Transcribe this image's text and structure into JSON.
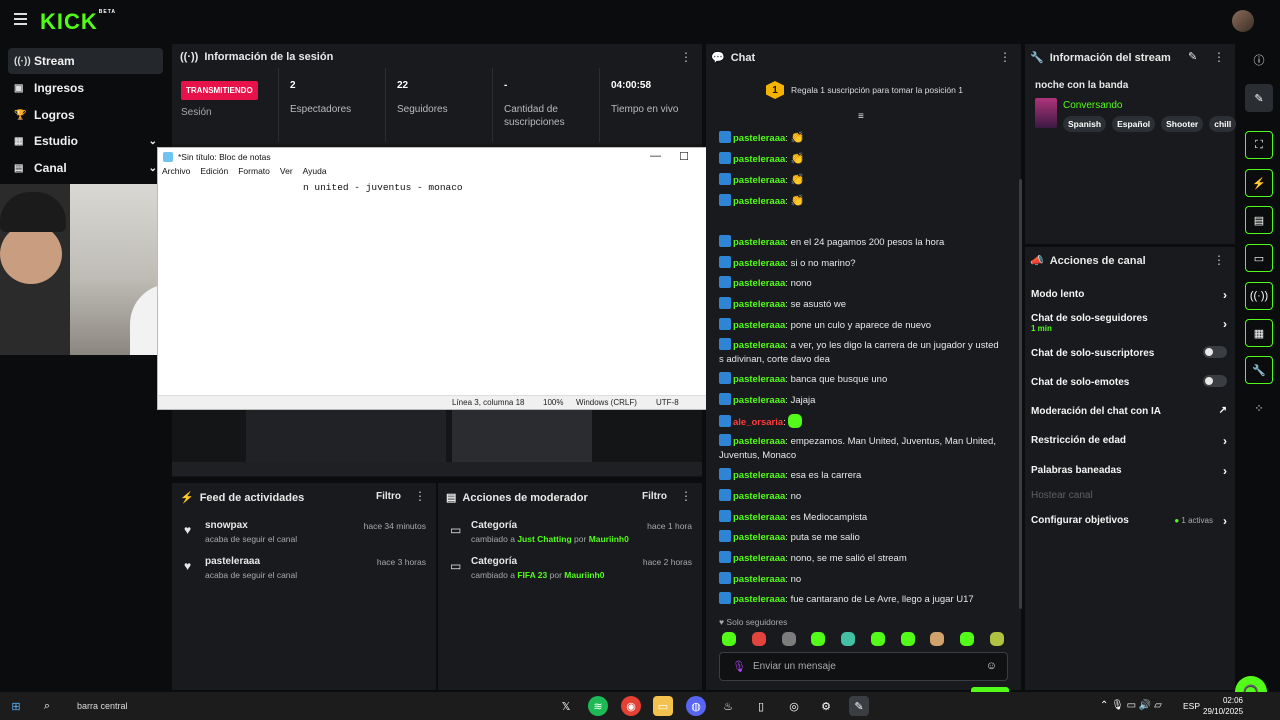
{
  "brand": {
    "logo": "KICK",
    "beta": "BETA"
  },
  "sidebar": {
    "items": [
      {
        "label": "Stream",
        "icon": "stream-icon"
      },
      {
        "label": "Ingresos",
        "icon": "revenue-icon"
      },
      {
        "label": "Logros",
        "icon": "trophy-icon"
      },
      {
        "label": "Estudio",
        "icon": "studio-icon"
      },
      {
        "label": "Canal",
        "icon": "channel-icon"
      }
    ]
  },
  "session": {
    "title": "Información de la sesión",
    "live_badge": "TRANSMITIENDO",
    "session_label": "Sesión",
    "viewers_value": "2",
    "viewers_label": "Espectadores",
    "followers_value": "22",
    "followers_label": "Seguidores",
    "subs_value": "-",
    "subs_label": "Cantidad de suscripciones",
    "time_value": "04:00:58",
    "time_label": "Tiempo en vivo"
  },
  "notepad": {
    "title": "*Sin título: Bloc de notas",
    "menu": [
      "Archivo",
      "Edición",
      "Formato",
      "Ver",
      "Ayuda"
    ],
    "text": "n united - juventus - monaco",
    "status_pos": "Línea 3, columna 18",
    "status_zoom": "100%",
    "status_eol": "Windows (CRLF)",
    "status_enc": "UTF-8"
  },
  "activity": {
    "title": "Feed de actividades",
    "filter": "Filtro",
    "items": [
      {
        "user": "snowpax",
        "desc": "acaba de seguir el canal",
        "time": "hace 34 minutos"
      },
      {
        "user": "pasteleraaa",
        "desc": "acaba de seguir el canal",
        "time": "hace 3 horas"
      }
    ]
  },
  "modactions": {
    "title": "Acciones de moderador",
    "filter": "Filtro",
    "items": [
      {
        "title": "Categoría",
        "prefix": "cambiado a",
        "category": "Just Chatting",
        "by": "por",
        "mod": "Mauriinh0",
        "time": "hace 1 hora"
      },
      {
        "title": "Categoría",
        "prefix": "cambiado a",
        "category": "FIFA 23",
        "by": "por",
        "mod": "Mauriinh0",
        "time": "hace 2 horas"
      }
    ]
  },
  "chat": {
    "title": "Chat",
    "gift_count": "1",
    "gift_text": "Regala 1 suscripción para tomar la posición 1",
    "followers_only": "Solo seguidores",
    "input_placeholder": "Enviar un mensaje",
    "send_label": "Chat",
    "messages": [
      {
        "user": "pasteleraaa",
        "text": ""
      },
      {
        "user": "pasteleraaa",
        "text": ""
      },
      {
        "user": "pasteleraaa",
        "text": ""
      },
      {
        "user": "pasteleraaa",
        "text": ""
      },
      {
        "user": "pasteleraaa",
        "text": "en el 24 pagamos 200 pesos la hora"
      },
      {
        "user": "pasteleraaa",
        "text": "si o no marino?"
      },
      {
        "user": "pasteleraaa",
        "text": "nono"
      },
      {
        "user": "pasteleraaa",
        "text": "se asustó we"
      },
      {
        "user": "pasteleraaa",
        "text": "pone un culo y aparece de nuevo"
      },
      {
        "user": "pasteleraaa",
        "text": "a ver, yo les digo la carrera de un jugador y usted s adivinan, corte davo dea"
      },
      {
        "user": "pasteleraaa",
        "text": "banca que busque uno"
      },
      {
        "user": "pasteleraaa",
        "text": "Jajaja"
      },
      {
        "user": "ale_orsaria",
        "text": ""
      },
      {
        "user": "pasteleraaa",
        "text": "empezamos. Man United, Juventus, Man United, Juventus, Monaco"
      },
      {
        "user": "pasteleraaa",
        "text": "esa es la carrera"
      },
      {
        "user": "pasteleraaa",
        "text": "no"
      },
      {
        "user": "pasteleraaa",
        "text": "es Mediocampista"
      },
      {
        "user": "pasteleraaa",
        "text": "puta se me salio"
      },
      {
        "user": "pasteleraaa",
        "text": "nono, se me salió el stream"
      },
      {
        "user": "pasteleraaa",
        "text": "no"
      },
      {
        "user": "pasteleraaa",
        "text": "fue cantarano de Le Avre, llego a jugar U17"
      }
    ]
  },
  "streaminfo": {
    "title": "Información del stream",
    "stream_title": "noche con la banda",
    "category": "Conversando",
    "tags": [
      "Spanish",
      "Español",
      "Shooter",
      "chill"
    ]
  },
  "channelactions": {
    "title": "Acciones de canal",
    "slow_mode": "Modo lento",
    "followers_only": "Chat de solo-seguidores",
    "followers_only_sub": "1 min",
    "subs_only": "Chat de solo-suscriptores",
    "emotes_only": "Chat de solo-emotes",
    "ai_mod": "Moderación del chat con IA",
    "age_restriction": "Restricción de edad",
    "banned_words": "Palabras baneadas",
    "host_channel": "Hostear canal",
    "goals": "Configurar objetivos",
    "goals_active": "1 activas"
  },
  "taskbar": {
    "search": "barra central",
    "lang": "ESP",
    "time": "02:06",
    "date": "29/10/2025"
  }
}
